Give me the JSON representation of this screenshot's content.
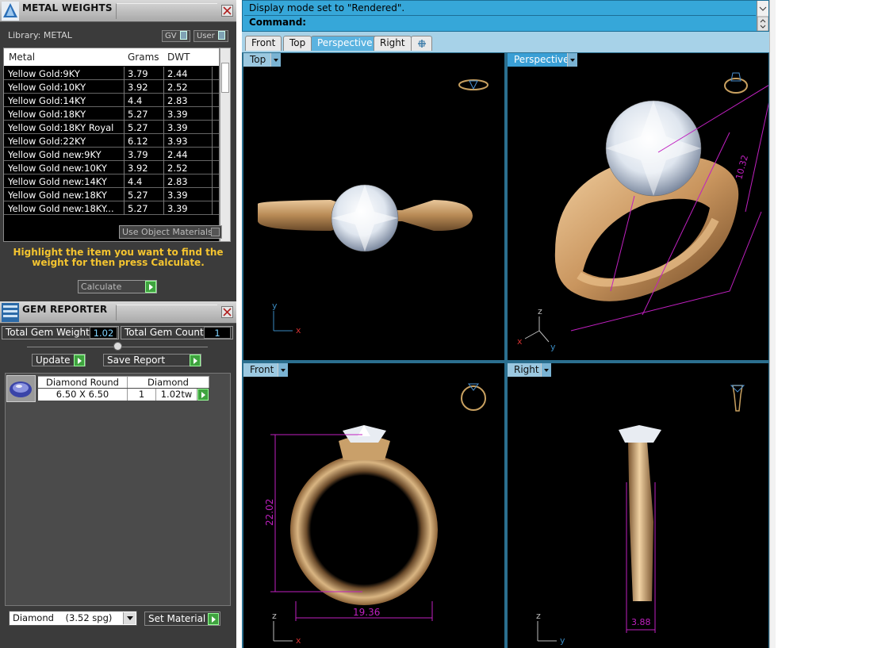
{
  "metal_weights": {
    "title": "METAL WEIGHTS",
    "library_label": "Library: METAL",
    "gv_label": "GV",
    "user_label": "User",
    "columns": [
      "Metal",
      "Grams",
      "DWT"
    ],
    "rows": [
      {
        "metal": "Yellow Gold:9KY",
        "grams": "3.79",
        "dwt": "2.44"
      },
      {
        "metal": "Yellow Gold:10KY",
        "grams": "3.92",
        "dwt": "2.52"
      },
      {
        "metal": "Yellow Gold:14KY",
        "grams": "4.4",
        "dwt": "2.83"
      },
      {
        "metal": "Yellow Gold:18KY",
        "grams": "5.27",
        "dwt": "3.39"
      },
      {
        "metal": "Yellow Gold:18KY Royal",
        "grams": "5.27",
        "dwt": "3.39"
      },
      {
        "metal": "Yellow Gold:22KY",
        "grams": "6.12",
        "dwt": "3.93"
      },
      {
        "metal": "Yellow Gold new:9KY",
        "grams": "3.79",
        "dwt": "2.44"
      },
      {
        "metal": "Yellow Gold new:10KY",
        "grams": "3.92",
        "dwt": "2.52"
      },
      {
        "metal": "Yellow Gold new:14KY",
        "grams": "4.4",
        "dwt": "2.83"
      },
      {
        "metal": "Yellow Gold new:18KY",
        "grams": "5.27",
        "dwt": "3.39"
      },
      {
        "metal": "Yellow Gold new:18KY...",
        "grams": "5.27",
        "dwt": "3.39"
      }
    ],
    "use_object_materials": "Use Object Materials",
    "hint": "Highlight the item you want to find the weight for then press Calculate.",
    "calculate_label": "Calculate"
  },
  "gem_reporter": {
    "title": "GEM REPORTER",
    "total_weight_label": "Total Gem Weight",
    "total_weight_value": "1.02",
    "total_count_label": "Total Gem Count",
    "total_count_value": "1",
    "update_label": "Update",
    "save_report_label": "Save Report",
    "gem": {
      "shape": "Diamond Round",
      "material": "Diamond",
      "size": "6.50 X 6.50",
      "count": "1",
      "weight": "1.02tw"
    },
    "material_select": "Diamond    (3.52 spg)",
    "set_material_label": "Set Material"
  },
  "command": {
    "status": "Display mode set to \"Rendered\".",
    "prompt": "Command:"
  },
  "view_tabs": [
    "Front",
    "Top",
    "Perspective",
    "Right"
  ],
  "active_tab": "Perspective",
  "viewports": {
    "top": {
      "label": "Top"
    },
    "perspective": {
      "label": "Perspective"
    },
    "front": {
      "label": "Front",
      "dim_height": "22.02",
      "dim_width": "19.36"
    },
    "right": {
      "label": "Right",
      "dim_width": "3.88"
    }
  },
  "persp_dim": "10.32",
  "axes": {
    "x": "x",
    "y": "y",
    "z": "z"
  },
  "colors": {
    "accent_blue": "#36a7d9",
    "hint_yellow": "#f4c430",
    "dimension_magenta": "#c020c0",
    "gold": "#d8b078",
    "go_green": "#3fa33f"
  },
  "icons": [
    "metal-weights-icon",
    "gem-reporter-icon",
    "close-icon",
    "new-tab-icon",
    "dropdown-icon"
  ]
}
